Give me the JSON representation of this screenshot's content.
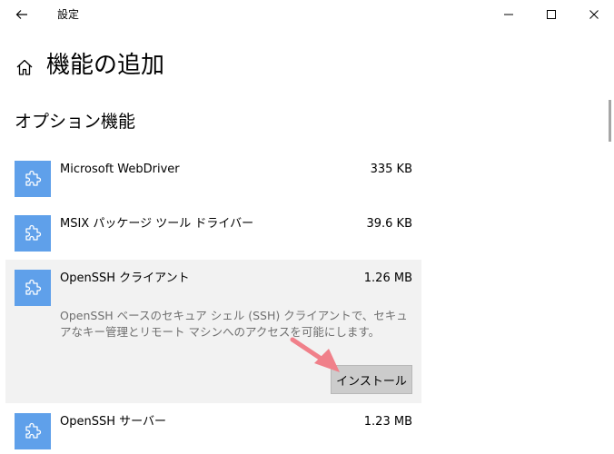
{
  "window": {
    "title": "設定",
    "back_icon": "back-arrow-icon",
    "controls": [
      "minimize-icon",
      "maximize-icon",
      "close-icon"
    ]
  },
  "page": {
    "title": "機能の追加",
    "home_icon": "home-icon"
  },
  "section": {
    "title": "オプション機能"
  },
  "features": [
    {
      "name": "Microsoft WebDriver",
      "size": "335 KB",
      "icon": "puzzle-piece-icon"
    },
    {
      "name": "MSIX パッケージ ツール ドライバー",
      "size": "39.6 KB",
      "icon": "puzzle-piece-icon"
    },
    {
      "name": "OpenSSH クライアント",
      "size": "1.26 MB",
      "icon": "puzzle-piece-icon",
      "description": "OpenSSH ベースのセキュア シェル (SSH) クライアントで、セキュアなキー管理とリモート マシンへのアクセスを可能にします。",
      "install_label": "インストール",
      "expanded": true
    },
    {
      "name": "OpenSSH サーバー",
      "size": "1.23 MB",
      "icon": "puzzle-piece-icon"
    }
  ],
  "colors": {
    "icon_tile": "#5fa0ea",
    "expanded_background": "#f2f2f2",
    "install_button": "#cccccc",
    "annotation_arrow": "#f0808a",
    "description_text": "#6f6f6f"
  }
}
